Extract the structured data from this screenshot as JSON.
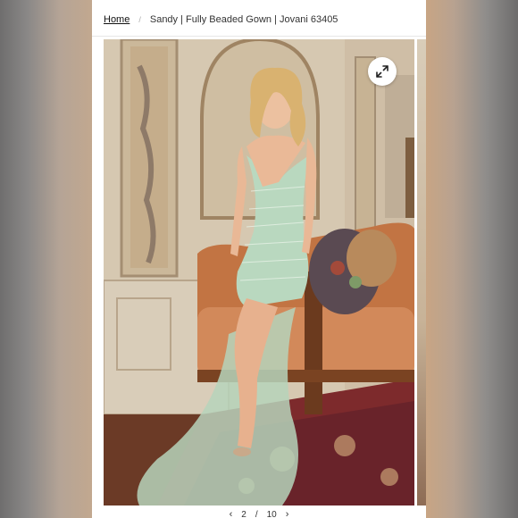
{
  "breadcrumb": {
    "home": "Home",
    "separator": "/",
    "current": "Sandy | Fully Beaded Gown | Jovani 63405"
  },
  "gallery": {
    "image_alt": "Model in mint green fully beaded gown seated on an orange velvet sofa",
    "expand_icon": "expand-arrows-icon",
    "current_index": "2",
    "separator": "/",
    "total": "10"
  },
  "colors": {
    "gown": "#b9d8bf",
    "sofa": "#c97a4c",
    "rug": "#7a2a28",
    "wall": "#d8cbb6"
  }
}
